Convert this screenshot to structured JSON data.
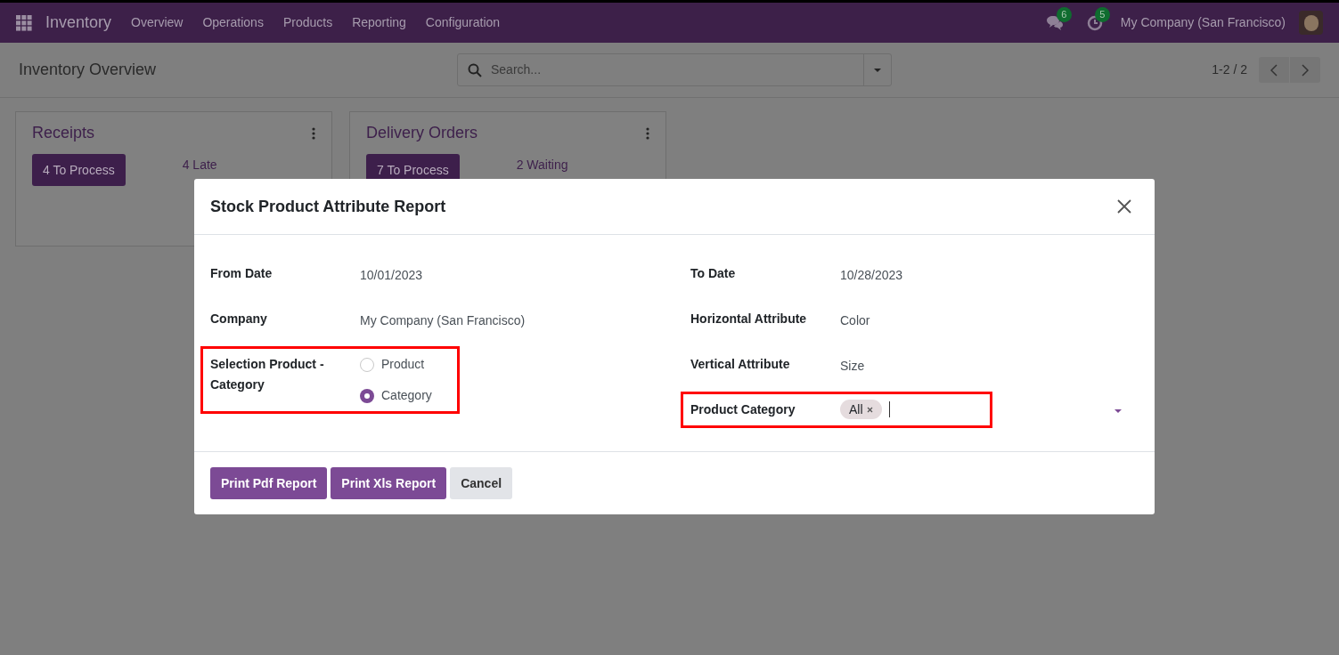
{
  "navbar": {
    "app": "Inventory",
    "menu": [
      "Overview",
      "Operations",
      "Products",
      "Reporting",
      "Configuration"
    ],
    "messages_badge": "6",
    "activities_badge": "5",
    "company": "My Company (San Francisco)"
  },
  "control_panel": {
    "title": "Inventory Overview",
    "search": {
      "placeholder": "Search..."
    },
    "pager": "1-2 / 2"
  },
  "cards": [
    {
      "title": "Receipts",
      "button": "4 To Process",
      "stat": "4 Late"
    },
    {
      "title": "Delivery Orders",
      "button": "7 To Process",
      "stat": "2 Waiting"
    }
  ],
  "dialog": {
    "title": "Stock Product Attribute Report",
    "left_fields": [
      {
        "kind": "text",
        "label": "From Date",
        "value": "10/01/2023",
        "highlighted": false
      },
      {
        "kind": "text",
        "label": "Company",
        "value": "My Company (San Francisco)",
        "highlighted": false
      },
      {
        "kind": "radio",
        "label": "Selection Product - Category",
        "highlighted": true,
        "options": [
          {
            "label": "Product",
            "selected": false
          },
          {
            "label": "Category",
            "selected": true
          }
        ]
      }
    ],
    "right_fields": [
      {
        "kind": "text",
        "label": "To Date",
        "value": "10/28/2023",
        "highlighted": false
      },
      {
        "kind": "text",
        "label": "Horizontal Attribute",
        "value": "Color",
        "highlighted": false
      },
      {
        "kind": "text",
        "label": "Vertical Attribute",
        "value": "Size",
        "highlighted": false
      },
      {
        "kind": "tags",
        "label": "Product Category",
        "highlighted": true,
        "tags": [
          "All"
        ]
      }
    ],
    "buttons": [
      {
        "label": "Print Pdf Report",
        "kind": "primary"
      },
      {
        "label": "Print Xls Report",
        "kind": "primary"
      },
      {
        "label": "Cancel",
        "kind": "secondary"
      }
    ]
  }
}
